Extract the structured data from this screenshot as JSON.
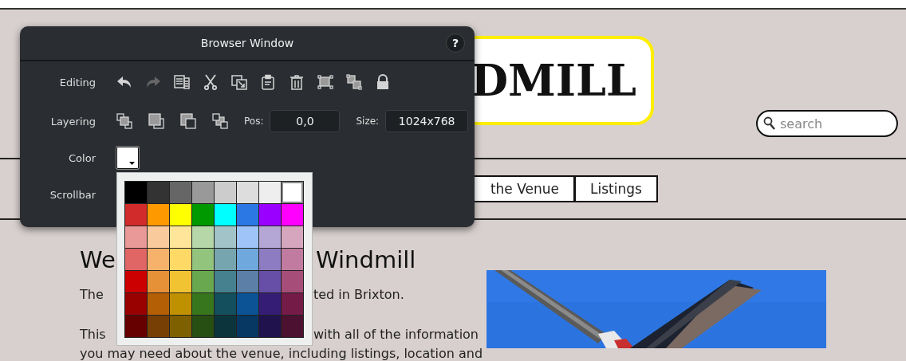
{
  "page": {
    "logo": "DMILL",
    "search": {
      "placeholder": "search"
    },
    "nav": [
      {
        "label": "the Venue"
      },
      {
        "label": "Listings"
      }
    ],
    "heading": [
      "We",
      "Windmill"
    ],
    "paragraphs": [
      {
        "lines": [
          [
            "The",
            "ted in Brixton."
          ]
        ]
      },
      {
        "lines": [
          [
            "This",
            "with all of the information"
          ],
          [
            "you may need about the venue, including listings, location and"
          ]
        ]
      }
    ]
  },
  "panel": {
    "title": "Browser Window",
    "help": "?",
    "rows": [
      {
        "label": "Editing",
        "kind": "tools",
        "tools": [
          {
            "kind": "undo",
            "disabled": false
          },
          {
            "kind": "redo",
            "disabled": true
          },
          {
            "kind": "duplicate",
            "disabled": false
          },
          {
            "kind": "cut",
            "disabled": false
          },
          {
            "kind": "paste",
            "disabled": false
          },
          {
            "kind": "clipboard",
            "disabled": false
          },
          {
            "kind": "trash",
            "disabled": false
          },
          {
            "kind": "group",
            "disabled": false
          },
          {
            "kind": "ungroup",
            "disabled": false
          },
          {
            "kind": "lock",
            "disabled": false
          }
        ]
      },
      {
        "label": "Layering",
        "kind": "tools",
        "tools": [
          {
            "kind": "front",
            "disabled": false
          },
          {
            "kind": "forward",
            "disabled": false
          },
          {
            "kind": "backward",
            "disabled": false
          },
          {
            "kind": "back",
            "disabled": false
          }
        ],
        "fields": [
          {
            "label": "Pos:",
            "value": "0,0"
          },
          {
            "label": "Size:",
            "value": "1024x768"
          }
        ]
      },
      {
        "label": "Color",
        "kind": "color",
        "color": "#ffffff",
        "expanded": true
      },
      {
        "label": "Scrollbar",
        "kind": "empty"
      }
    ]
  },
  "palette": {
    "rows": [
      {
        "swatches": [
          {
            "color": "#000000",
            "selected": false
          },
          {
            "color": "#333333",
            "selected": false
          },
          {
            "color": "#666666",
            "selected": false
          },
          {
            "color": "#999999",
            "selected": false
          },
          {
            "color": "#cccccc",
            "selected": false
          },
          {
            "color": "#dddddd",
            "selected": false
          },
          {
            "color": "#eeeeee",
            "selected": false
          },
          {
            "color": "#ffffff",
            "selected": true
          }
        ]
      },
      {
        "swatches": [
          {
            "color": "#d22b2b",
            "selected": false
          },
          {
            "color": "#ff9900",
            "selected": false
          },
          {
            "color": "#ffff00",
            "selected": false
          },
          {
            "color": "#009900",
            "selected": false
          },
          {
            "color": "#00ffff",
            "selected": false
          },
          {
            "color": "#2b78e4",
            "selected": false
          },
          {
            "color": "#9900ff",
            "selected": false
          },
          {
            "color": "#ff00ff",
            "selected": false
          }
        ]
      },
      {
        "swatches": [
          {
            "color": "#ea9999",
            "selected": false
          },
          {
            "color": "#f9cb9c",
            "selected": false
          },
          {
            "color": "#ffe599",
            "selected": false
          },
          {
            "color": "#b6d7a8",
            "selected": false
          },
          {
            "color": "#a2c4c9",
            "selected": false
          },
          {
            "color": "#9fc5f8",
            "selected": false
          },
          {
            "color": "#b4a7d6",
            "selected": false
          },
          {
            "color": "#d5a6bd",
            "selected": false
          }
        ]
      },
      {
        "swatches": [
          {
            "color": "#e06666",
            "selected": false
          },
          {
            "color": "#f6b26b",
            "selected": false
          },
          {
            "color": "#ffd966",
            "selected": false
          },
          {
            "color": "#93c47d",
            "selected": false
          },
          {
            "color": "#76a5af",
            "selected": false
          },
          {
            "color": "#6fa8dc",
            "selected": false
          },
          {
            "color": "#8e7cc3",
            "selected": false
          },
          {
            "color": "#c27ba0",
            "selected": false
          }
        ]
      },
      {
        "swatches": [
          {
            "color": "#cc0000",
            "selected": false
          },
          {
            "color": "#e69138",
            "selected": false
          },
          {
            "color": "#f1c232",
            "selected": false
          },
          {
            "color": "#6aa84f",
            "selected": false
          },
          {
            "color": "#45818e",
            "selected": false
          },
          {
            "color": "#5b7fa6",
            "selected": false
          },
          {
            "color": "#674ea7",
            "selected": false
          },
          {
            "color": "#a64d79",
            "selected": false
          }
        ]
      },
      {
        "swatches": [
          {
            "color": "#990000",
            "selected": false
          },
          {
            "color": "#b45f06",
            "selected": false
          },
          {
            "color": "#bf9000",
            "selected": false
          },
          {
            "color": "#38761d",
            "selected": false
          },
          {
            "color": "#134f5c",
            "selected": false
          },
          {
            "color": "#0b5394",
            "selected": false
          },
          {
            "color": "#351c75",
            "selected": false
          },
          {
            "color": "#741b47",
            "selected": false
          }
        ]
      },
      {
        "swatches": [
          {
            "color": "#660000",
            "selected": false
          },
          {
            "color": "#783f04",
            "selected": false
          },
          {
            "color": "#7f6000",
            "selected": false
          },
          {
            "color": "#274e13",
            "selected": false
          },
          {
            "color": "#0c343d",
            "selected": false
          },
          {
            "color": "#073763",
            "selected": false
          },
          {
            "color": "#20124d",
            "selected": false
          },
          {
            "color": "#4c1130",
            "selected": false
          }
        ]
      }
    ]
  }
}
